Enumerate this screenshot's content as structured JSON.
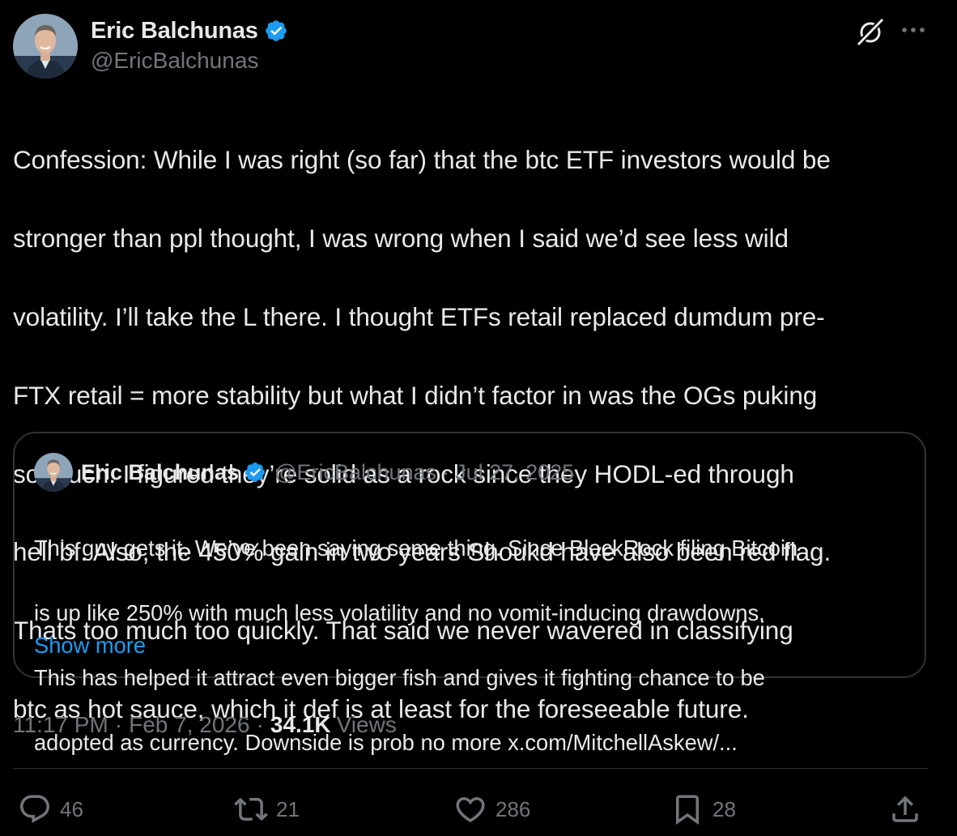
{
  "tweet": {
    "author": {
      "display_name": "Eric Balchunas",
      "handle": "@EricBalchunas",
      "verified": true
    },
    "text_lines": [
      "Confession: While I was right (so far) that the btc ETF investors would be",
      "stronger than ppl thought, I was wrong when I said we’d see less wild",
      "volatility. I’ll take the L there. I thought ETFs retail replaced dumdum pre-",
      "FTX retail = more stability but what I didn’t factor in was the OGs puking",
      "so much. I figured they’re solid as a rock since they HODL-ed through",
      "hell bf. Also, the 450% gain in two years Shoukd have also been red flag.",
      "Thats too much too quickly. That said we never wavered in classifying",
      "btc as hot sauce, which it def is at least for the foreseeable future."
    ],
    "quote": {
      "display_name": "Eric Balchunas",
      "handle": "@EricBalchunas",
      "separator": "·",
      "date": "Jul 27, 2025",
      "text_lines": [
        "This guy gets it. We’ve been saying same thing. Since BlackRock filing Bitcoin",
        "is up like 250% with much less volatility and no vomit-inducing drawdowns.",
        "This has helped it attract even bigger fish and gives it fighting chance to be",
        "adopted as currency. Downside is prob no more x.com/MitchellAskew/..."
      ],
      "show_more": "Show more"
    },
    "meta": {
      "time": "11:17 PM",
      "separator": "·",
      "date": "Feb 7, 2026",
      "views_count": "34.1K",
      "views_label": "Views"
    },
    "actions": {
      "replies": "46",
      "reposts": "21",
      "likes": "286",
      "bookmarks": "28"
    }
  },
  "icons": {
    "header": [
      "grok-icon",
      "more-icon"
    ],
    "actions": [
      "reply-icon",
      "repost-icon",
      "like-icon",
      "bookmark-icon",
      "share-icon"
    ]
  },
  "colors": {
    "background": "#000000",
    "text_primary": "#e7e9ea",
    "text_secondary": "#71767b",
    "link": "#1d9bf0",
    "verified_badge": "#1d9bf0",
    "border": "#2f3336"
  }
}
